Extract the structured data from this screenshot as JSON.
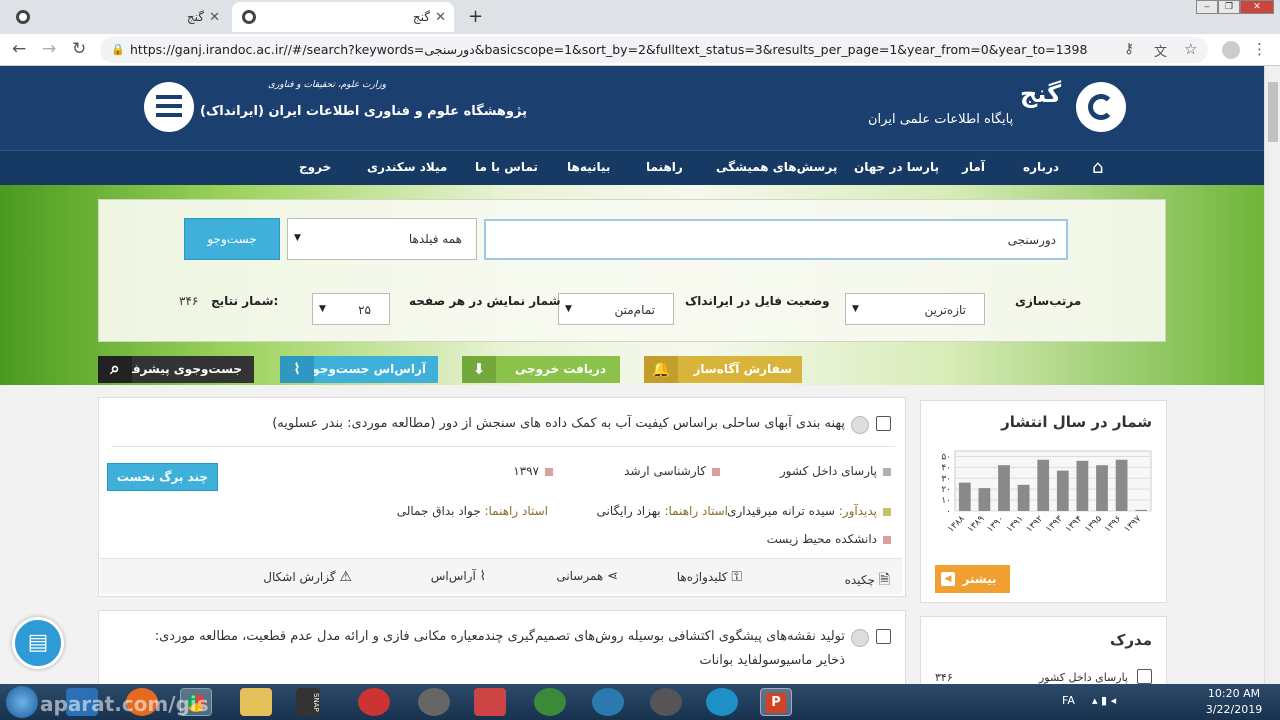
{
  "browser": {
    "tabs": [
      {
        "title": "گنج"
      },
      {
        "title": "گنج"
      }
    ],
    "url": "https://ganj.irandoc.ac.ir//#/search?keywords=دورسنجی&basicscope=1&sort_by=2&fulltext_status=3&results_per_page=1&year_from=0&year_to=1398"
  },
  "header": {
    "site_name": "گنج",
    "site_subtitle": "پایگاه اطلاعات علمی ایران",
    "org_ministry": "وزارت علوم، تحقیقات و فناوری",
    "org_name": "پژوهشگاه علوم و فناوری اطلاعات ایران (ایرانداک)"
  },
  "nav": {
    "items": [
      "درباره",
      "آمار",
      "پارسا در جهان",
      "پرسش‌های همیشگی",
      "راهنما",
      "بیانیه‌ها",
      "تماس با ما",
      "میلاد سکندری",
      "خروج"
    ]
  },
  "search": {
    "query": "دورسنجی",
    "scope": "همه فیلدها",
    "button": "جست‌وجو",
    "sort_label": "مرتب‌سازی",
    "sort_value": "تازه‌ترین",
    "file_status_label": "وضعیت فایل در ایرانداک",
    "file_status_value": "تمام‌متن",
    "per_page_label": "شمار نمایش در هر صفحه",
    "per_page_value": "۲۵",
    "results_label": "شمار نتایج:",
    "results_count": "۳۴۶"
  },
  "toolbar": {
    "alert": "سفارش آگاه‌ساز",
    "export": "دریافت خروجی",
    "rss": "آر‌اس‌اس جست‌وجو",
    "advanced": "جست‌وجوی پیشرفته"
  },
  "results": [
    {
      "title": "پهنه بندی آبهای ساحلی براساس کیفیت آب به کمک داده های سنجش از دور (مطالعه موردی: بندر عسلویه)",
      "source": "پارسای داخل کشور",
      "degree": "کارشناسی ارشد",
      "year": "۱۳۹۷",
      "creator_label": "پدیدآور:",
      "creator": "سیده ترانه میرقیداری",
      "advisor_label": "استاد راهنما:",
      "advisor1": "بهزاد رایگانی",
      "advisor2_label": "استاد راهنما:",
      "advisor2": "جواد بداق جمالی",
      "faculty": "دانشکده محیط زیست",
      "preview_button": "چند برگ نخست",
      "actions": {
        "abstract": "چکیده",
        "keywords": "کلیدواژه‌ها",
        "share": "همرسانی",
        "rss": "آر‌اس‌اس",
        "report": "گزارش اشکال"
      }
    },
    {
      "title": "تولید نقشه‌های پیشگوی اکتشافی بوسیله روش‌های تصمیم‌گیری چندمعیاره مکانی فازی و ارائه مدل عدم قطعیت، مطالعه موردی:",
      "title_line2": "ذخایر ماسیوسولفاید بوانات"
    }
  ],
  "sidebar": {
    "year_title": "شمار در سال انتشار",
    "more_button": "بیشتر",
    "degree_title": "مدرک",
    "degree_item": "پارسای داخل کشور",
    "degree_count": "۳۴۶"
  },
  "chart_data": {
    "type": "bar",
    "categories": [
      "۱۳۸۸",
      "۱۳۸۹",
      "۱۳۹۰",
      "۱۳۹۱",
      "۱۳۹۲",
      "۱۳۹۳",
      "۱۳۹۴",
      "۱۳۹۵",
      "۱۳۹۶",
      "۱۳۹۷"
    ],
    "values": [
      26,
      21,
      42,
      24,
      47,
      37,
      46,
      42,
      47,
      1
    ],
    "y_ticks": [
      "۰",
      "۱۰",
      "۲۰",
      "۳۰",
      "۴۰",
      "۵۰"
    ],
    "ylim": [
      0,
      55
    ],
    "bar_color": "#8a8a8a",
    "grid": true
  },
  "taskbar": {
    "lang": "FA",
    "time": "10:20 AM",
    "date": "3/22/2019",
    "watermark": "aparat.com/gis"
  },
  "colors": {
    "header": "#1b3f6e",
    "accent_blue": "#3fb0d9",
    "accent_orange": "#f0a030",
    "alert_yellow": "#d8b53a"
  }
}
